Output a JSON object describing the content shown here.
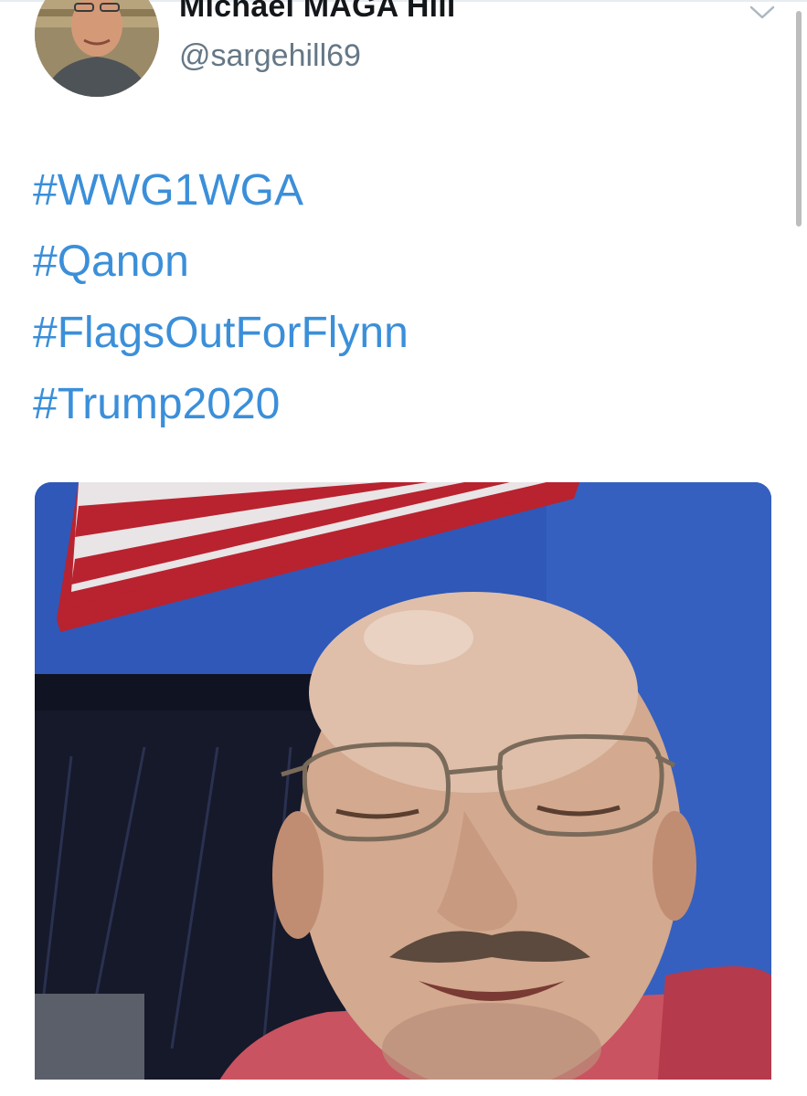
{
  "tweet": {
    "author": {
      "display_name": "Michael MAGA Hill",
      "handle": "@sargehill69"
    },
    "menu_icon": "chevron-down-icon",
    "hashtags": [
      "#WWG1WGA",
      "#Qanon",
      "#FlagsOutForFlynn",
      "#Trump2020"
    ],
    "media": {
      "type": "video-still"
    }
  },
  "colors": {
    "link": "#3b8fd9",
    "name": "#14171a",
    "handle": "#657786",
    "wall": "#2f58b8",
    "flag_red": "#b8232f"
  }
}
